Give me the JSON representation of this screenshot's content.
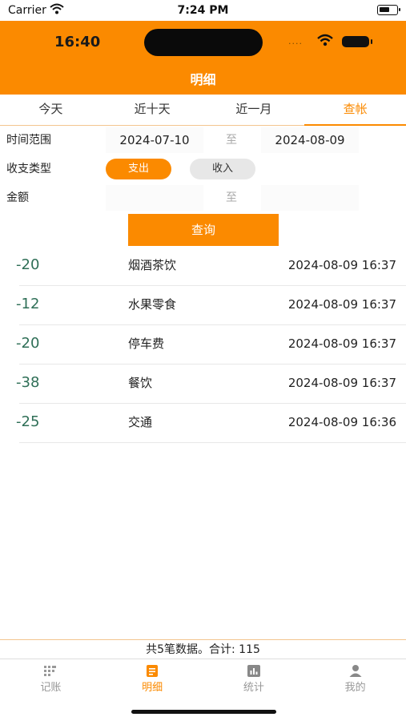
{
  "status_bar": {
    "carrier": "Carrier",
    "time": "7:24 PM"
  },
  "inner_status": {
    "time": "16:40"
  },
  "header": {
    "title": "明细"
  },
  "tabs": [
    {
      "label": "今天",
      "active": false
    },
    {
      "label": "近十天",
      "active": false
    },
    {
      "label": "近一月",
      "active": false
    },
    {
      "label": "查帐",
      "active": true
    }
  ],
  "filter": {
    "time_range": {
      "label": "时间范围",
      "start": "2024-07-10",
      "separator": "至",
      "end": "2024-08-09"
    },
    "type": {
      "label": "收支类型",
      "expense_label": "支出",
      "income_label": "收入",
      "selected": "支出"
    },
    "amount": {
      "label": "金额",
      "min": "",
      "separator": "至",
      "max": ""
    },
    "query_label": "查询"
  },
  "records": [
    {
      "amount": "-20",
      "category": "烟酒茶饮",
      "time": "2024-08-09 16:37"
    },
    {
      "amount": "-12",
      "category": "水果零食",
      "time": "2024-08-09 16:37"
    },
    {
      "amount": "-20",
      "category": "停车费",
      "time": "2024-08-09 16:37"
    },
    {
      "amount": "-38",
      "category": "餐饮",
      "time": "2024-08-09 16:37"
    },
    {
      "amount": "-25",
      "category": "交通",
      "time": "2024-08-09 16:36"
    }
  ],
  "summary": "共5笔数据。合计: 115",
  "bottom_nav": [
    {
      "label": "记账",
      "icon": "keypad-icon",
      "active": false
    },
    {
      "label": "明细",
      "icon": "receipt-icon",
      "active": true
    },
    {
      "label": "统计",
      "icon": "bar-chart-icon",
      "active": false
    },
    {
      "label": "我的",
      "icon": "person-icon",
      "active": false
    }
  ],
  "colors": {
    "accent": "#fb8a00",
    "amount": "#2f6f57"
  }
}
